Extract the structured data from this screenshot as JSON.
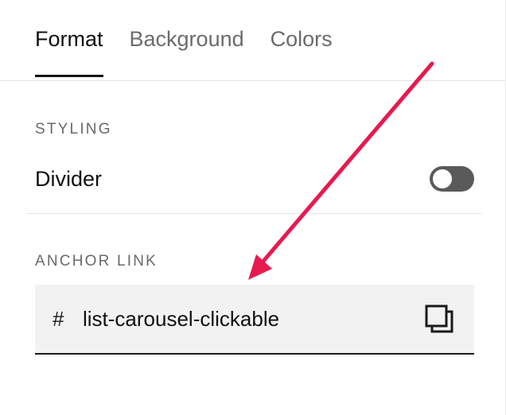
{
  "tabs": [
    {
      "label": "Format",
      "active": true
    },
    {
      "label": "Background",
      "active": false
    },
    {
      "label": "Colors",
      "active": false
    }
  ],
  "styling": {
    "section_label": "STYLING",
    "divider_label": "Divider",
    "divider_enabled": false
  },
  "anchor": {
    "section_label": "ANCHOR LINK",
    "prefix": "#",
    "value": "list-carousel-clickable"
  },
  "icons": {
    "copy": "copy-icon",
    "annotation": "annotation-arrow"
  },
  "colors": {
    "annotation_arrow": "#e8194f",
    "toggle_track": "#5a5a5a",
    "field_background": "#f2f2f2"
  }
}
